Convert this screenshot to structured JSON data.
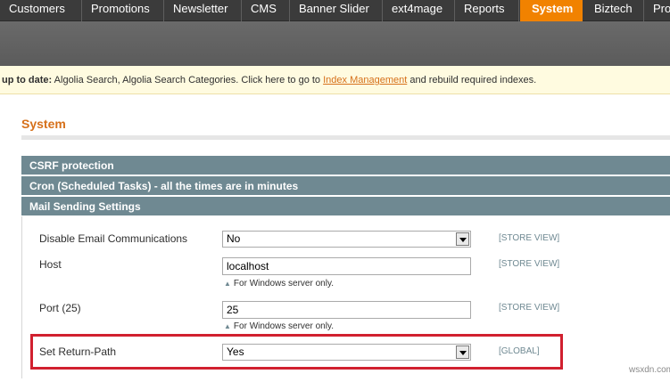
{
  "nav": {
    "items": [
      {
        "label": "Customers"
      },
      {
        "label": "Promotions"
      },
      {
        "label": "Newsletter"
      },
      {
        "label": "CMS"
      },
      {
        "label": "Banner Slider"
      },
      {
        "label": "ext4mage"
      },
      {
        "label": "Reports"
      },
      {
        "label": "System",
        "active": true
      },
      {
        "label": "Biztech"
      },
      {
        "label": "Pro"
      }
    ]
  },
  "notice": {
    "lead": "up to date:",
    "text": " Algolia Search, Algolia Search Categories. Click here to go to ",
    "link": "Index Management",
    "tail": " and rebuild required indexes."
  },
  "page": {
    "title": "System"
  },
  "sections": [
    {
      "title": "CSRF protection"
    },
    {
      "title": "Cron (Scheduled Tasks) - all the times are in minutes"
    },
    {
      "title": "Mail Sending Settings"
    }
  ],
  "mail_settings": {
    "disable_email": {
      "label": "Disable Email Communications",
      "value": "No",
      "scope": "[STORE VIEW]"
    },
    "host": {
      "label": "Host",
      "value": "localhost",
      "note": "For Windows server only.",
      "scope": "[STORE VIEW]"
    },
    "port": {
      "label": "Port (25)",
      "value": "25",
      "note": "For Windows server only.",
      "scope": "[STORE VIEW]"
    },
    "return_path": {
      "label": "Set Return-Path",
      "value": "Yes",
      "scope": "[GLOBAL]"
    }
  },
  "colors": {
    "accent": "#f18200",
    "section_header": "#6f8992",
    "highlight": "#d1202f"
  },
  "watermark": "wsxdn.com"
}
